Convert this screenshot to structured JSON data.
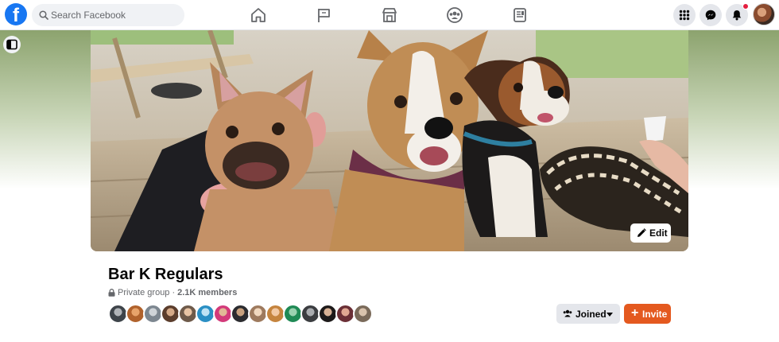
{
  "header": {
    "logo_letter": "f",
    "search_placeholder": "Search Facebook",
    "nav_icons": [
      "home-icon",
      "pages-flag-icon",
      "marketplace-icon",
      "groups-icon",
      "gaming-icon"
    ],
    "right_icons": [
      "menu-grid-icon",
      "messenger-icon",
      "notifications-bell-icon",
      "profile-avatar"
    ]
  },
  "cover": {
    "edit_label": "Edit"
  },
  "group": {
    "name": "Bar K Regulars",
    "privacy": "Private group",
    "separator": "·",
    "members": "2.1K members",
    "member_avatar_count": 16
  },
  "actions": {
    "joined_label": "Joined",
    "invite_label": "Invite"
  },
  "colors": {
    "facebook_blue": "#1877f2",
    "invite_orange": "#e4591f",
    "button_gray": "#e4e6eb",
    "notification_red": "#e41e3f"
  }
}
